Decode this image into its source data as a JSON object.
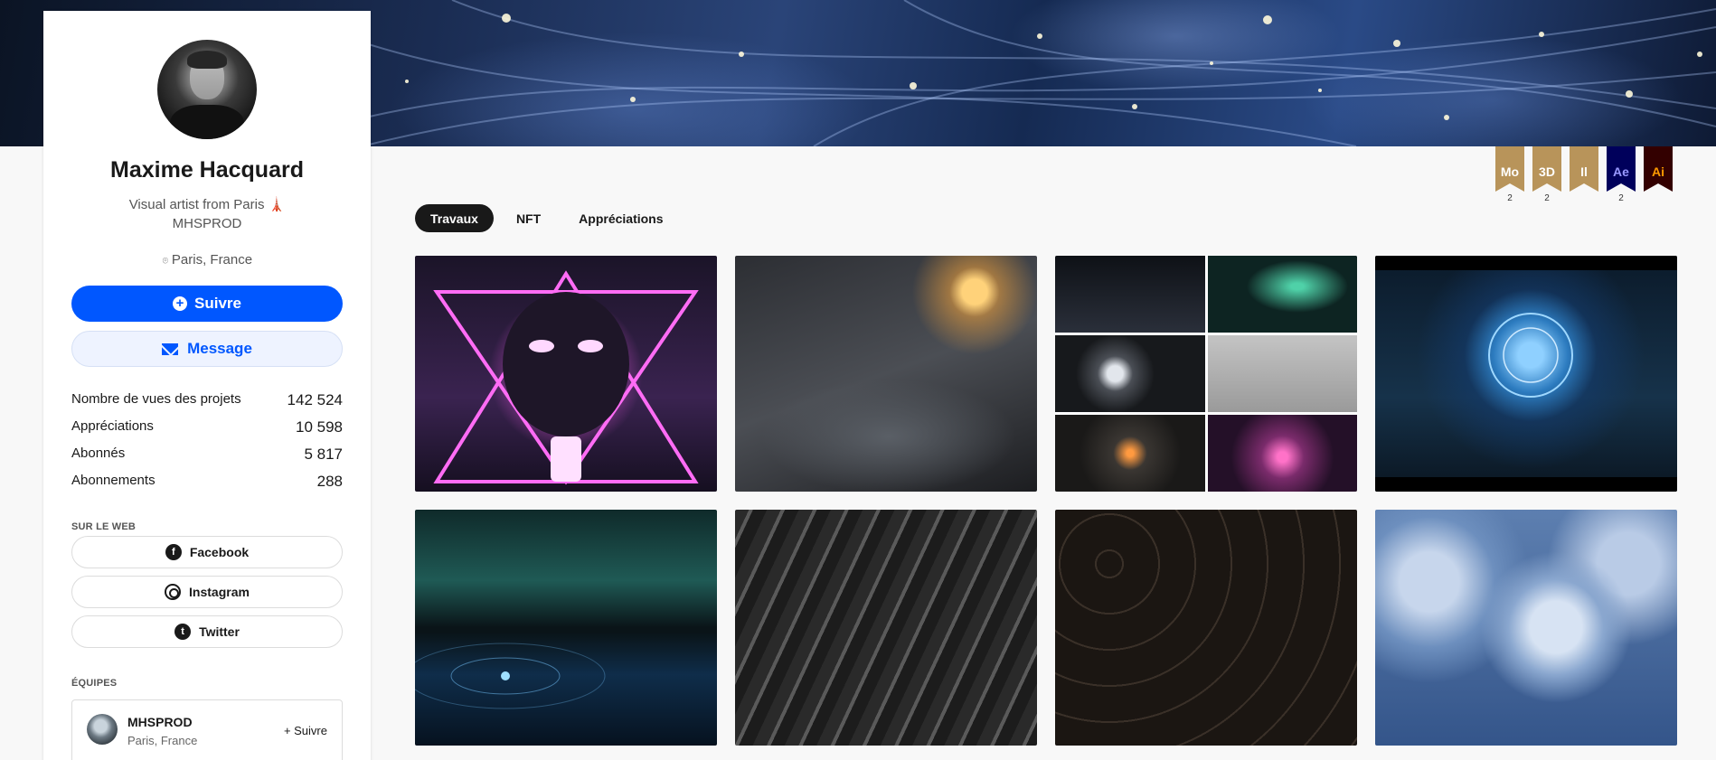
{
  "profile": {
    "name": "Maxime Hacquard",
    "bio_line1": "Visual artist from Paris 🗼",
    "bio_line2": "MHSPROD",
    "location": "Paris, France"
  },
  "actions": {
    "follow_label": "Suivre",
    "message_label": "Message"
  },
  "stats": [
    {
      "label": "Nombre de vues des projets",
      "value": "142 524"
    },
    {
      "label": "Appréciations",
      "value": "10 598"
    },
    {
      "label": "Abonnés",
      "value": "5 817"
    },
    {
      "label": "Abonnements",
      "value": "288"
    }
  ],
  "web": {
    "section_label": "SUR LE WEB",
    "links": [
      {
        "label": "Facebook",
        "icon": "facebook-icon"
      },
      {
        "label": "Instagram",
        "icon": "instagram-icon"
      },
      {
        "label": "Twitter",
        "icon": "twitter-icon"
      }
    ]
  },
  "teams": {
    "section_label": "ÉQUIPES",
    "items": [
      {
        "name": "MHSPROD",
        "location": "Paris, France",
        "follow_label": "+ Suivre"
      }
    ]
  },
  "badges": [
    {
      "label": "Mo",
      "count": "2",
      "color": "#b8945a",
      "text_color": "#ffffff"
    },
    {
      "label": "3D",
      "count": "2",
      "color": "#b8945a",
      "text_color": "#ffffff"
    },
    {
      "label": "Il",
      "count": "",
      "color": "#b8945a",
      "text_color": "#ffffff"
    },
    {
      "label": "Ae",
      "count": "2",
      "color": "#00005b",
      "text_color": "#9999ff"
    },
    {
      "label": "Ai",
      "count": "",
      "color": "#330000",
      "text_color": "#ff9a00"
    }
  ],
  "tabs": [
    {
      "label": "Travaux",
      "active": true
    },
    {
      "label": "NFT",
      "active": false
    },
    {
      "label": "Appréciations",
      "active": false
    }
  ],
  "colors": {
    "accent": "#0057ff",
    "tab_active_bg": "#191919"
  }
}
